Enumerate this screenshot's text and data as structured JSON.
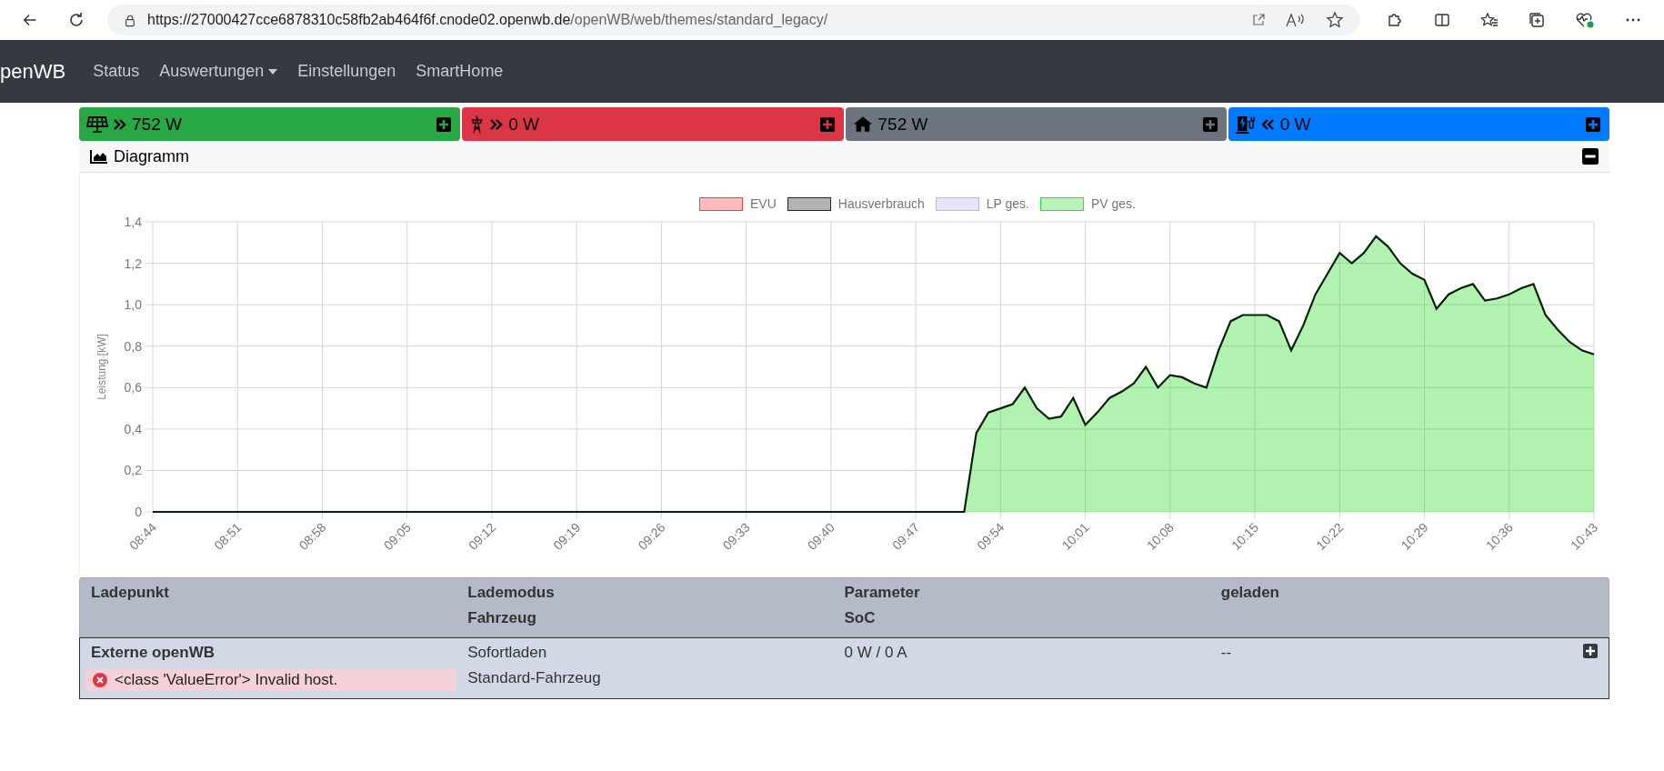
{
  "browser": {
    "url_host": "https://27000427cce6878310c58fb2ab464f6f.cnode02.openwb.de",
    "url_path": "/openWB/web/themes/standard_legacy/"
  },
  "navbar": {
    "brand": "penWB",
    "items": [
      {
        "label": "Status",
        "dropdown": false
      },
      {
        "label": "Auswertungen",
        "dropdown": true
      },
      {
        "label": "Einstellungen",
        "dropdown": false
      },
      {
        "label": "SmartHome",
        "dropdown": false
      }
    ]
  },
  "power_bars": [
    {
      "kind": "pv",
      "arrow": {
        "kind": "right"
      },
      "value": "752 W",
      "color": "#28a745"
    },
    {
      "kind": "grid",
      "arrow": {
        "kind": "right"
      },
      "value": "0 W",
      "color": "#dc3545"
    },
    {
      "kind": "house",
      "value": "752 W",
      "color": "#6c757d"
    },
    {
      "kind": "charge",
      "arrow": {
        "kind": "left"
      },
      "value": "0 W",
      "color": "#007bff"
    }
  ],
  "diagram": {
    "title": "Diagramm",
    "expanded": true,
    "chart_data": {
      "type": "area",
      "ylabel": "Leistung [kW]",
      "ylim": [
        0,
        1.4
      ],
      "grid": true,
      "categories": [
        "08:44",
        null,
        null,
        null,
        null,
        null,
        null,
        "08:51",
        null,
        null,
        null,
        null,
        null,
        null,
        "08:58",
        null,
        null,
        null,
        null,
        null,
        null,
        "09:05",
        null,
        null,
        null,
        null,
        null,
        null,
        "09:12",
        null,
        null,
        null,
        null,
        null,
        null,
        "09:19",
        null,
        null,
        null,
        null,
        null,
        null,
        "09:26",
        null,
        null,
        null,
        null,
        null,
        null,
        "09:33",
        null,
        null,
        null,
        null,
        null,
        null,
        "09:40",
        null,
        null,
        null,
        null,
        null,
        null,
        "09:47",
        null,
        null,
        null,
        null,
        null,
        null,
        "09:54",
        null,
        null,
        null,
        null,
        null,
        null,
        "10:01",
        null,
        null,
        null,
        null,
        null,
        null,
        "10:08",
        null,
        null,
        null,
        null,
        null,
        null,
        "10:15",
        null,
        null,
        null,
        null,
        null,
        null,
        "10:22",
        null,
        null,
        null,
        null,
        null,
        null,
        "10:29",
        null,
        null,
        null,
        null,
        null,
        null,
        "10:36",
        null,
        null,
        null,
        null,
        null,
        null,
        "10:43"
      ],
      "yticks": [
        {
          "value": 0,
          "label": "0"
        },
        {
          "value": 0.2,
          "label": "0,2"
        },
        {
          "value": 0.4,
          "label": "0,4"
        },
        {
          "value": 0.6,
          "label": "0,6"
        },
        {
          "value": 0.8,
          "label": "0,8"
        },
        {
          "value": 1,
          "label": "1,0"
        },
        {
          "value": 1.2,
          "label": "1,2"
        },
        {
          "value": 1.4,
          "label": "1,4"
        }
      ],
      "series": [
        {
          "name": "EVU",
          "color": "#ff3b3b",
          "values": [
            null,
            null,
            null,
            null,
            null,
            null,
            null,
            null,
            null,
            null,
            null,
            null,
            null,
            null,
            null,
            null,
            null,
            null,
            null,
            null,
            null,
            null,
            null,
            null,
            null,
            null,
            null,
            null,
            null,
            null,
            null,
            null,
            null,
            null,
            null,
            null,
            null,
            null,
            null,
            null,
            null,
            null,
            null,
            null,
            null,
            null,
            null,
            null,
            null,
            null,
            null,
            null,
            null,
            null,
            null,
            null,
            null,
            null,
            null,
            null,
            null,
            null,
            null,
            null,
            null,
            null,
            null,
            null,
            null,
            null,
            null,
            null,
            null,
            null,
            null,
            null,
            null,
            null,
            null,
            null,
            null,
            null,
            null,
            null,
            null,
            null,
            null,
            null,
            null,
            null,
            null,
            null,
            null,
            null,
            null,
            null,
            null,
            null,
            null,
            null,
            null,
            null,
            null,
            null,
            null,
            null,
            null,
            null,
            null,
            null,
            null,
            null,
            null,
            null,
            null,
            null,
            null,
            null,
            null,
            null
          ]
        },
        {
          "name": "Hausverbrauch",
          "color": "#1f2a1f",
          "values": [
            null,
            null,
            null,
            null,
            null,
            null,
            null,
            null,
            null,
            null,
            null,
            null,
            null,
            null,
            null,
            null,
            null,
            null,
            null,
            null,
            null,
            null,
            null,
            null,
            null,
            null,
            null,
            null,
            null,
            null,
            null,
            null,
            null,
            null,
            null,
            null,
            null,
            null,
            null,
            null,
            null,
            null,
            null,
            null,
            null,
            null,
            null,
            null,
            null,
            null,
            null,
            null,
            null,
            null,
            null,
            null,
            null,
            null,
            null,
            null,
            null,
            null,
            null,
            null,
            null,
            null,
            null,
            null,
            null,
            null,
            null,
            null,
            null,
            null,
            null,
            null,
            null,
            null,
            null,
            null,
            null,
            null,
            null,
            null,
            null,
            null,
            null,
            null,
            null,
            null,
            null,
            null,
            null,
            null,
            null,
            null,
            null,
            null,
            null,
            null,
            null,
            null,
            null,
            null,
            null,
            null,
            null,
            null,
            null,
            null,
            null,
            null,
            null,
            null,
            null,
            null,
            null,
            null,
            null,
            null
          ]
        },
        {
          "name": "LP ges.",
          "color": "#b4b4ff",
          "values": [
            null,
            null,
            null,
            null,
            null,
            null,
            null,
            null,
            null,
            null,
            null,
            null,
            null,
            null,
            null,
            null,
            null,
            null,
            null,
            null,
            null,
            null,
            null,
            null,
            null,
            null,
            null,
            null,
            null,
            null,
            null,
            null,
            null,
            null,
            null,
            null,
            null,
            null,
            null,
            null,
            null,
            null,
            null,
            null,
            null,
            null,
            null,
            null,
            null,
            null,
            null,
            null,
            null,
            null,
            null,
            null,
            null,
            null,
            null,
            null,
            null,
            null,
            null,
            null,
            null,
            null,
            null,
            null,
            null,
            null,
            null,
            null,
            null,
            null,
            null,
            null,
            null,
            null,
            null,
            null,
            null,
            null,
            null,
            null,
            null,
            null,
            null,
            null,
            null,
            null,
            null,
            null,
            null,
            null,
            null,
            null,
            null,
            null,
            null,
            null,
            null,
            null,
            null,
            null,
            null,
            null,
            null,
            null,
            null,
            null,
            null,
            null,
            null,
            null,
            null,
            null,
            null,
            null,
            null,
            null
          ]
        },
        {
          "name": "PV ges.",
          "color": "#33dd33",
          "values": [
            0,
            0,
            0,
            0,
            0,
            0,
            0,
            0,
            0,
            0,
            0,
            0,
            0,
            0,
            0,
            0,
            0,
            0,
            0,
            0,
            0,
            0,
            0,
            0,
            0,
            0,
            0,
            0,
            0,
            0,
            0,
            0,
            0,
            0,
            0,
            0,
            0,
            0,
            0,
            0,
            0,
            0,
            0,
            0,
            0,
            0,
            0,
            0,
            0,
            0,
            0,
            0,
            0,
            0,
            0,
            0,
            0,
            0,
            0,
            0,
            0,
            0,
            0,
            0,
            0,
            0,
            0,
            0,
            0.38,
            0.48,
            0.5,
            0.52,
            0.6,
            0.5,
            0.45,
            0.46,
            0.55,
            0.42,
            0.48,
            0.55,
            0.58,
            0.62,
            0.7,
            0.6,
            0.66,
            0.65,
            0.62,
            0.6,
            0.78,
            0.92,
            0.95,
            0.95,
            0.95,
            0.92,
            0.78,
            0.9,
            1.05,
            1.15,
            1.25,
            1.2,
            1.25,
            1.33,
            1.28,
            1.2,
            1.15,
            1.12,
            0.98,
            1.05,
            1.08,
            1.1,
            1.02,
            1.03,
            1.05,
            1.08,
            1.1,
            0.95,
            0.88,
            0.82,
            0.78,
            0.76
          ]
        }
      ]
    }
  },
  "chargepoints": {
    "columns": [
      [
        "Ladepunkt"
      ],
      [
        "Lademodus",
        "Fahrzeug"
      ],
      [
        "Parameter",
        "SoC"
      ],
      [
        "geladen"
      ]
    ],
    "rows": [
      {
        "name": "Externe openWB",
        "error": "<class 'ValueError'> Invalid host.",
        "mode": "Sofortladen",
        "vehicle": "Standard-Fahrzeug",
        "parameter": "0 W / 0 A",
        "charged": "--",
        "expanded": false
      }
    ]
  }
}
